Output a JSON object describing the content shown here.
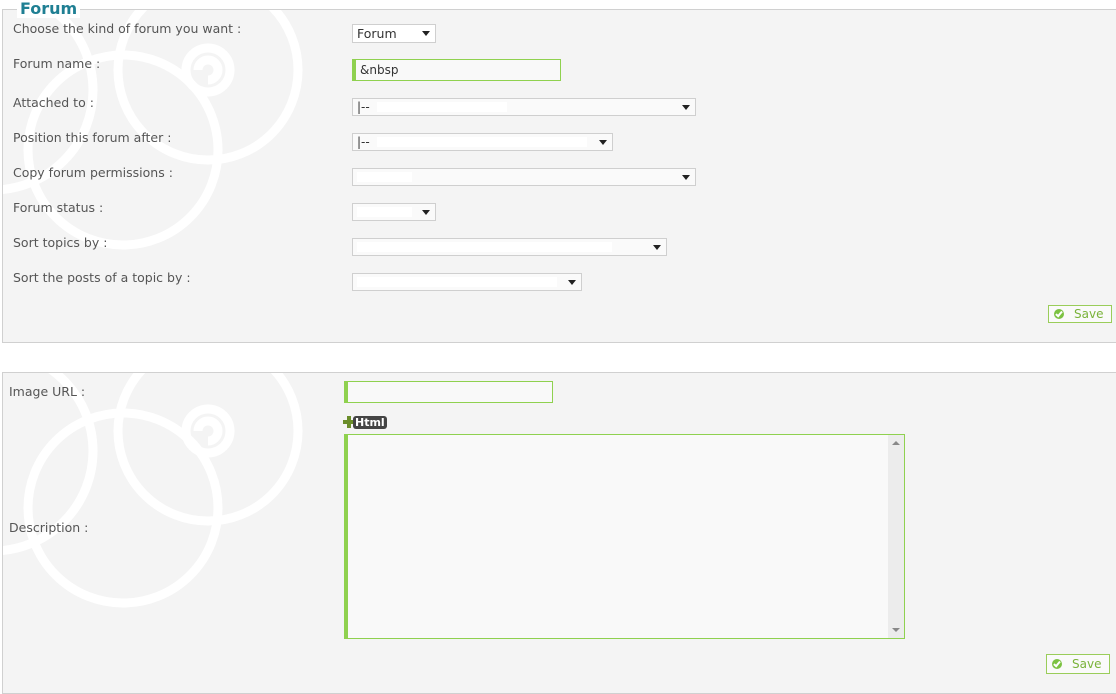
{
  "forum_section": {
    "legend": "Forum",
    "fields": [
      {
        "label": "Choose the kind of forum you want :",
        "type": "select",
        "value": "Forum"
      },
      {
        "label": "Forum name :",
        "type": "text",
        "value": "&nbsp"
      },
      {
        "label": "Attached to :",
        "type": "select",
        "value": "|--"
      },
      {
        "label": "Position this forum after :",
        "type": "select",
        "value": "|--"
      },
      {
        "label": "Copy forum permissions :",
        "type": "select",
        "value": ""
      },
      {
        "label": "Forum status :",
        "type": "select",
        "value": ""
      },
      {
        "label": "Sort topics by :",
        "type": "select",
        "value": ""
      },
      {
        "label": "Sort the posts of a topic by :",
        "type": "select",
        "value": ""
      }
    ],
    "save_label": "Save"
  },
  "details_section": {
    "image_url_label": "Image URL :",
    "image_url_value": "",
    "html_button_label": "Html",
    "description_label": "Description :",
    "description_value": "",
    "save_label": "Save"
  },
  "colors": {
    "accent_green": "#8fd14f",
    "legend_teal": "#1f7f93",
    "panel_bg": "#f4f4f4"
  }
}
